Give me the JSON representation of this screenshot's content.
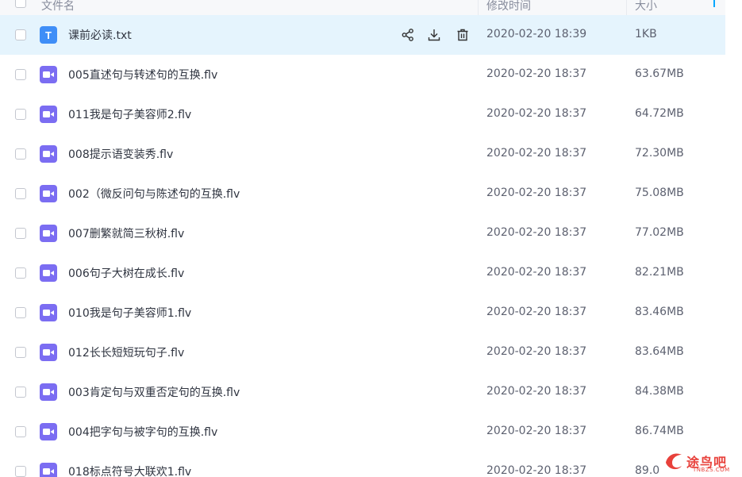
{
  "header": {
    "col_name": "文件名",
    "col_modified": "修改时间",
    "col_size": "大小"
  },
  "files": [
    {
      "name": "课前必读.txt",
      "type": "txt",
      "date": "2020-02-20 18:39",
      "size": "1KB",
      "hover": true
    },
    {
      "name": "005直述句与转述句的互换.flv",
      "type": "video",
      "date": "2020-02-20 18:37",
      "size": "63.67MB"
    },
    {
      "name": "011我是句子美容师2.flv",
      "type": "video",
      "date": "2020-02-20 18:37",
      "size": "64.72MB"
    },
    {
      "name": "008提示语变装秀.flv",
      "type": "video",
      "date": "2020-02-20 18:37",
      "size": "72.30MB"
    },
    {
      "name": "002（微反问句与陈述句的互换.flv",
      "type": "video",
      "date": "2020-02-20 18:37",
      "size": "75.08MB"
    },
    {
      "name": "007删繁就简三秋树.flv",
      "type": "video",
      "date": "2020-02-20 18:37",
      "size": "77.02MB"
    },
    {
      "name": "006句子大树在成长.flv",
      "type": "video",
      "date": "2020-02-20 18:37",
      "size": "82.21MB"
    },
    {
      "name": "010我是句子美容师1.flv",
      "type": "video",
      "date": "2020-02-20 18:37",
      "size": "83.46MB"
    },
    {
      "name": "012长长短短玩句子.flv",
      "type": "video",
      "date": "2020-02-20 18:37",
      "size": "83.64MB"
    },
    {
      "name": "003肯定句与双重否定句的互换.flv",
      "type": "video",
      "date": "2020-02-20 18:37",
      "size": "84.38MB"
    },
    {
      "name": "004把字句与被字句的互换.flv",
      "type": "video",
      "date": "2020-02-20 18:37",
      "size": "86.74MB"
    },
    {
      "name": "018标点符号大联欢1.flv",
      "type": "video",
      "date": "2020-02-20 18:37",
      "size": "89.0"
    }
  ],
  "icons": {
    "txt_letter": "T",
    "share": "share-icon",
    "download": "download-icon",
    "delete": "trash-icon"
  },
  "watermark": {
    "text": "途鸟吧",
    "sub": "TNBZS.COM"
  },
  "colors": {
    "accent": "#06a7ff",
    "hover_row": "#e5f4fd",
    "video_icon": "#7b6df2",
    "txt_icon": "#3f8ef7"
  }
}
